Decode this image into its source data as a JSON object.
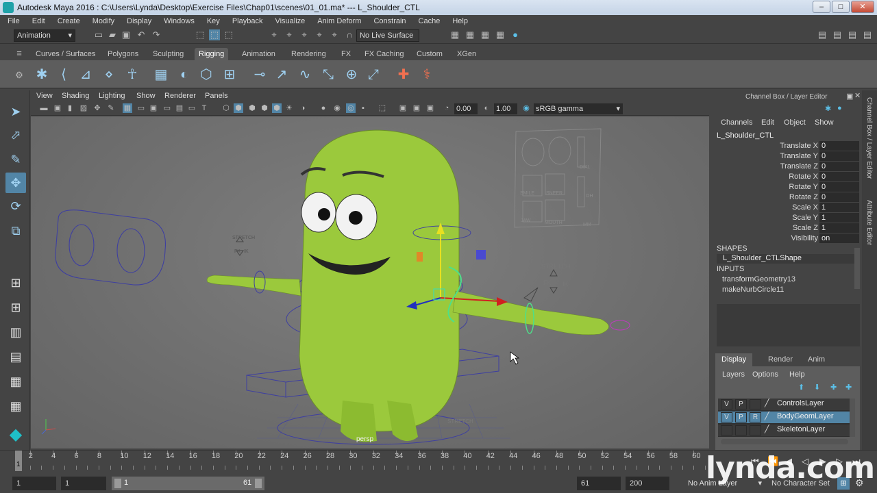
{
  "window": {
    "title": "Autodesk Maya 2016 :  C:\\Users\\Lynda\\Desktop\\Exercise Files\\Chap01\\scenes\\01_01.ma*    ---    L_Shoulder_CTL",
    "minimize": "–",
    "maximize": "□",
    "close": "✕"
  },
  "menu": [
    "File",
    "Edit",
    "Create",
    "Modify",
    "Display",
    "Windows",
    "Key",
    "Playback",
    "Visualize",
    "Anim Deform",
    "Constrain",
    "Cache",
    "Help"
  ],
  "status_line": {
    "mode": "Animation",
    "live_surface": "No Live Surface"
  },
  "shelf_tabs": [
    "Curves / Surfaces",
    "Polygons",
    "Sculpting",
    "Rigging",
    "Animation",
    "Rendering",
    "FX",
    "FX Caching",
    "Custom",
    "XGen"
  ],
  "active_shelf": "Rigging",
  "viewport": {
    "menu": [
      "View",
      "Shading",
      "Lighting",
      "Show",
      "Renderer",
      "Panels"
    ],
    "exposure": "0.00",
    "gamma": "1.00",
    "color_space": "sRGB gamma",
    "camera": "persp",
    "labels": {
      "stretch": "STRETCH",
      "fk": "FK",
      "ik": "IK",
      "dial": "DIAL",
      "smile": "SMILE",
      "sneer": "SNEER",
      "oh": "OH",
      "jaw": "JAW",
      "mouth": "MOUTH",
      "mm": "MM"
    }
  },
  "channel_box": {
    "title": "Channel Box / Layer Editor",
    "menu": [
      "Channels",
      "Edit",
      "Object",
      "Show"
    ],
    "object": "L_Shoulder_CTL",
    "attributes": [
      {
        "name": "Translate X",
        "value": "0"
      },
      {
        "name": "Translate Y",
        "value": "0"
      },
      {
        "name": "Translate Z",
        "value": "0"
      },
      {
        "name": "Rotate X",
        "value": "0"
      },
      {
        "name": "Rotate Y",
        "value": "0"
      },
      {
        "name": "Rotate Z",
        "value": "0"
      },
      {
        "name": "Scale X",
        "value": "1"
      },
      {
        "name": "Scale Y",
        "value": "1"
      },
      {
        "name": "Scale Z",
        "value": "1"
      },
      {
        "name": "Visibility",
        "value": "on"
      }
    ],
    "shapes_header": "SHAPES",
    "shape": "L_Shoulder_CTLShape",
    "inputs_header": "INPUTS",
    "inputs": [
      "transformGeometry13",
      "makeNurbCircle11"
    ]
  },
  "side_tabs": [
    "Channel Box / Layer Editor",
    "Attribute Editor"
  ],
  "layer_editor": {
    "tabs": [
      "Display",
      "Render",
      "Anim"
    ],
    "active_tab": "Display",
    "menu": [
      "Layers",
      "Options",
      "Help"
    ],
    "layers": [
      {
        "v": "V",
        "p": "P",
        "r": "",
        "name": "ControlsLayer",
        "selected": false
      },
      {
        "v": "V",
        "p": "P",
        "r": "R",
        "name": "BodyGeomLayer",
        "selected": true
      },
      {
        "v": "",
        "p": "",
        "r": "",
        "name": "SkeletonLayer",
        "selected": false
      }
    ]
  },
  "timeline": {
    "ticks": [
      "1",
      "2",
      "4",
      "6",
      "8",
      "10",
      "12",
      "14",
      "16",
      "18",
      "20",
      "22",
      "24",
      "26",
      "28",
      "30",
      "32",
      "34",
      "36",
      "38",
      "40",
      "42",
      "44",
      "46",
      "48",
      "50",
      "52",
      "54",
      "56",
      "58",
      "60"
    ],
    "current_frame": "1"
  },
  "range": {
    "start": "1",
    "playback_start": "1",
    "slider_start": "1",
    "slider_end": "61",
    "playback_end": "61",
    "end": "200",
    "anim_layer": "No Anim Layer",
    "character_set": "No Character Set"
  },
  "watermark": "lynda.com"
}
